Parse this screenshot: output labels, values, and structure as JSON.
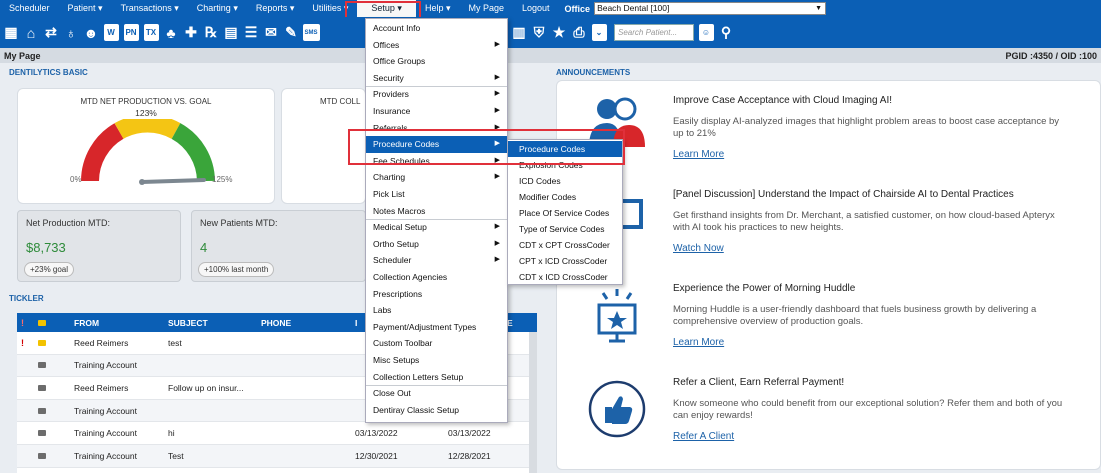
{
  "menubar": {
    "items": [
      "Scheduler",
      "Patient ▾",
      "Transactions ▾",
      "Charting ▾",
      "Reports ▾",
      "Utilities ▾",
      "Setup ▾",
      "Help ▾",
      "My Page",
      "Logout"
    ],
    "office_label": "Office",
    "office_value": "Beach Dental [100]"
  },
  "toolbar": {
    "icons": [
      "calendar-icon",
      "home-icon",
      "transfer-icon",
      "tooth-icon",
      "people-icon",
      "tooth-list-icon",
      "pn-icon",
      "tx-icon",
      "user-add-icon",
      "user-add-2-icon",
      "rx-icon",
      "card-icon",
      "list-icon",
      "mail-icon",
      "message-icon",
      "sms-icon"
    ],
    "icons_right": [
      "globe-icon",
      "stats-icon",
      "shield-icon",
      "star-list-icon",
      "printer-icon",
      "chevron-down-icon"
    ],
    "pn_label": "PN",
    "tx_label": "TX",
    "sms_label": "SMS",
    "search_placeholder": "Search Patient..."
  },
  "pagebar": {
    "title": "My Page",
    "ids": "PGID :4350  /  OID :100"
  },
  "dentilytics": {
    "section_title": "DENTILYTICS BASIC",
    "gauge1": {
      "title": "MTD NET PRODUCTION VS. GOAL",
      "value_pct": "123%",
      "min_label": "0%",
      "max_label": "125%",
      "level_fraction": 0.98
    },
    "gauge2": {
      "title": "MTD COLL"
    },
    "net_production": {
      "label": "Net Production MTD:",
      "value": "$8,733",
      "pill": "+23% goal"
    },
    "new_patients": {
      "label": "New Patients MTD:",
      "value": "4",
      "pill": "+100% last month"
    }
  },
  "tickler": {
    "section_title": "TICKLER",
    "headers": {
      "from": "FROM",
      "subject": "SUBJECT",
      "phone": "PHONE",
      "col4": "I",
      "col5": "E"
    },
    "rows": [
      {
        "flag": "!",
        "mail": "yellow",
        "from": "Reed Reimers",
        "subject": "test",
        "date1": "",
        "date2": ""
      },
      {
        "flag": "",
        "mail": "grey",
        "from": "Training Account",
        "subject": "",
        "date1": "",
        "date2": ""
      },
      {
        "flag": "",
        "mail": "grey",
        "from": "Reed Reimers",
        "subject": "Follow up on insur...",
        "date1": "",
        "date2": ""
      },
      {
        "flag": "",
        "mail": "grey",
        "from": "Training Account",
        "subject": "",
        "date1": "",
        "date2": ""
      },
      {
        "flag": "",
        "mail": "grey",
        "from": "Training Account",
        "subject": "hi",
        "date1": "03/13/2022",
        "date2": "03/13/2022"
      },
      {
        "flag": "",
        "mail": "grey",
        "from": "Training Account",
        "subject": "Test",
        "date1": "12/30/2021",
        "date2": "12/28/2021"
      }
    ]
  },
  "announcements": {
    "section_title": "ANNOUNCEMENTS",
    "items": [
      {
        "title": "Improve Case Acceptance with Cloud Imaging AI!",
        "body": "Easily display AI-analyzed images that highlight problem areas to boost case acceptance by up to 21%",
        "link": "Learn More"
      },
      {
        "title": "[Panel Discussion] Understand the Impact of Chairside AI to Dental Practices",
        "body": "Get firsthand insights from Dr. Merchant, a satisfied customer, on how cloud-based Apteryx with AI took his practices to new heights.",
        "link": "Watch Now"
      },
      {
        "title": "Experience the Power of Morning Huddle",
        "body": "Morning Huddle is a user-friendly dashboard that fuels business growth by delivering a comprehensive overview of production goals.",
        "link": "Learn More"
      },
      {
        "title": "Refer a Client, Earn Referral Payment!",
        "body": "Know someone who could benefit from our exceptional solution? Refer them and both of you can enjoy rewards!",
        "link": "Refer A Client"
      }
    ]
  },
  "setup_menu": {
    "items": [
      {
        "label": "Account Info",
        "sub": false
      },
      {
        "label": "Offices",
        "sub": true
      },
      {
        "label": "Office Groups",
        "sub": false
      },
      {
        "label": "Security",
        "sub": true
      },
      {
        "label": "Providers",
        "sub": true
      },
      {
        "label": "Insurance",
        "sub": true
      },
      {
        "label": "Referrals",
        "sub": true
      },
      {
        "label": "Procedure Codes",
        "sub": true
      },
      {
        "label": "Fee Schedules",
        "sub": true
      },
      {
        "label": "Charting",
        "sub": true
      },
      {
        "label": "Pick List",
        "sub": false
      },
      {
        "label": "Notes Macros",
        "sub": false
      },
      {
        "label": "Medical Setup",
        "sub": true
      },
      {
        "label": "Ortho Setup",
        "sub": true
      },
      {
        "label": "Scheduler",
        "sub": true
      },
      {
        "label": "Collection Agencies",
        "sub": false
      },
      {
        "label": "Prescriptions",
        "sub": false
      },
      {
        "label": "Labs",
        "sub": false
      },
      {
        "label": "Payment/Adjustment Types",
        "sub": false
      },
      {
        "label": "Custom Toolbar",
        "sub": false
      },
      {
        "label": "Misc Setups",
        "sub": false
      },
      {
        "label": "Collection Letters Setup",
        "sub": false
      },
      {
        "label": "Close Out",
        "sub": false
      },
      {
        "label": "Dentiray Classic Setup",
        "sub": false
      }
    ],
    "highlighted": "Procedure Codes",
    "sub_arrow": "▶"
  },
  "procedure_submenu": {
    "items": [
      "Procedure Codes",
      "Explosion Codes",
      "ICD Codes",
      "Modifier Codes",
      "Place Of Service Codes",
      "Type of Service Codes",
      "CDT x CPT CrossCoder",
      "CPT x ICD CrossCoder",
      "CDT x ICD CrossCoder"
    ],
    "highlighted": "Procedure Codes"
  },
  "colors": {
    "brand_blue": "#0b5fb5",
    "highlight_red": "#e0303a",
    "value_green": "#2e8b3a"
  }
}
